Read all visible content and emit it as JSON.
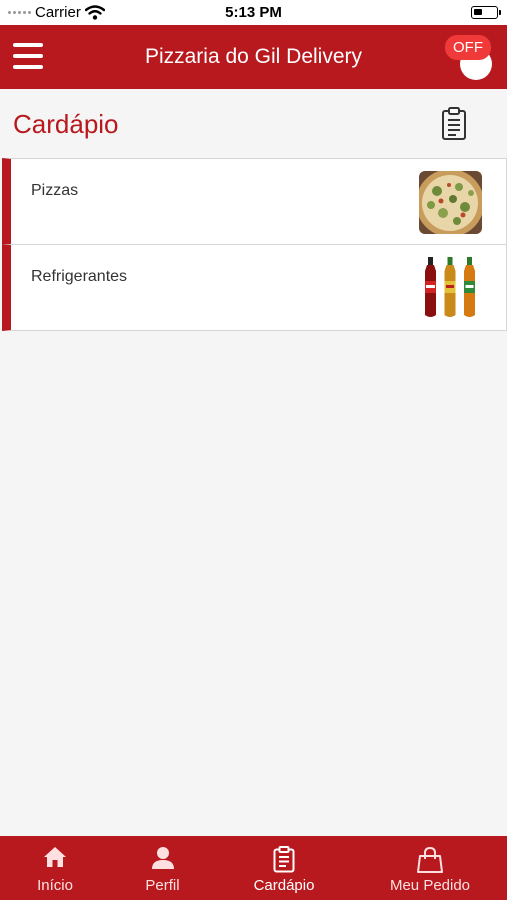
{
  "status_bar": {
    "carrier": "Carrier",
    "time": "5:13 PM"
  },
  "header": {
    "title": "Pizzaria do Gil Delivery",
    "off_badge": "OFF"
  },
  "page": {
    "title": "Cardápio"
  },
  "categories": [
    {
      "name": "Pizzas",
      "image": "pizza-image"
    },
    {
      "name": "Refrigerantes",
      "image": "soda-bottles-image"
    }
  ],
  "tabs": [
    {
      "label": "Início",
      "icon": "home-icon",
      "active": false
    },
    {
      "label": "Perfil",
      "icon": "user-icon",
      "active": false
    },
    {
      "label": "Cardápio",
      "icon": "clipboard-icon",
      "active": true
    },
    {
      "label": "Meu Pedido",
      "icon": "shopping-bag-icon",
      "active": false
    }
  ],
  "colors": {
    "primary": "#b7191e",
    "badge": "#f03a3a",
    "background": "#f5f5f5"
  }
}
